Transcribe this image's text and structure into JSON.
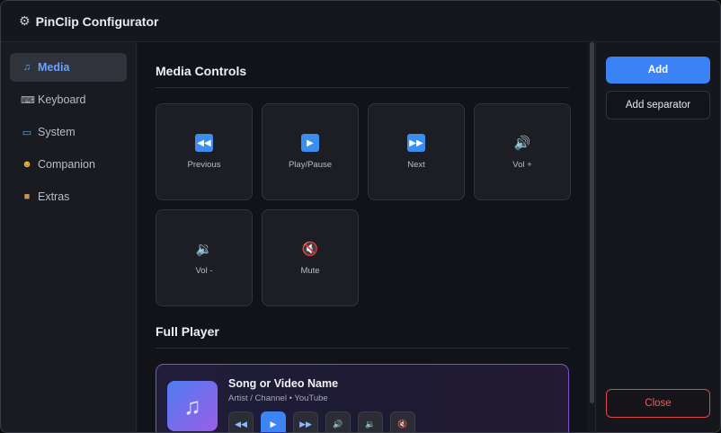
{
  "app": {
    "title": "PinClip Configurator",
    "icon": "gear-icon"
  },
  "sidebar": {
    "items": [
      {
        "label": "Media",
        "icon": "music-note-icon",
        "active": true
      },
      {
        "label": "Keyboard",
        "icon": "keyboard-icon",
        "active": false
      },
      {
        "label": "System",
        "icon": "laptop-icon",
        "active": false
      },
      {
        "label": "Companion",
        "icon": "cat-face-icon",
        "active": false
      },
      {
        "label": "Extras",
        "icon": "package-icon",
        "active": false
      }
    ]
  },
  "media_controls": {
    "title": "Media Controls",
    "tiles": [
      {
        "label": "Previous",
        "icon": "rewind-icon"
      },
      {
        "label": "Play/Pause",
        "icon": "play-icon"
      },
      {
        "label": "Next",
        "icon": "fast-forward-icon"
      },
      {
        "label": "Vol +",
        "icon": "volume-up-icon"
      },
      {
        "label": "Vol -",
        "icon": "volume-down-icon"
      },
      {
        "label": "Mute",
        "icon": "mute-icon"
      }
    ]
  },
  "full_player": {
    "title": "Full Player",
    "song_title": "Song or Video Name",
    "subtitle": "Artist / Channel • YouTube",
    "art_icon": "music-notes-icon",
    "controls": [
      "rewind-icon",
      "play-icon",
      "fast-forward-icon",
      "volume-up-icon",
      "volume-down-icon",
      "mute-icon"
    ]
  },
  "actions": {
    "add_label": "Add",
    "add_separator_label": "Add separator",
    "close_label": "Close"
  },
  "colors": {
    "accent": "#3b82f6",
    "active_nav": "#6aa2ff",
    "player_border": "#7b52c9",
    "danger": "#ef5c5c"
  }
}
